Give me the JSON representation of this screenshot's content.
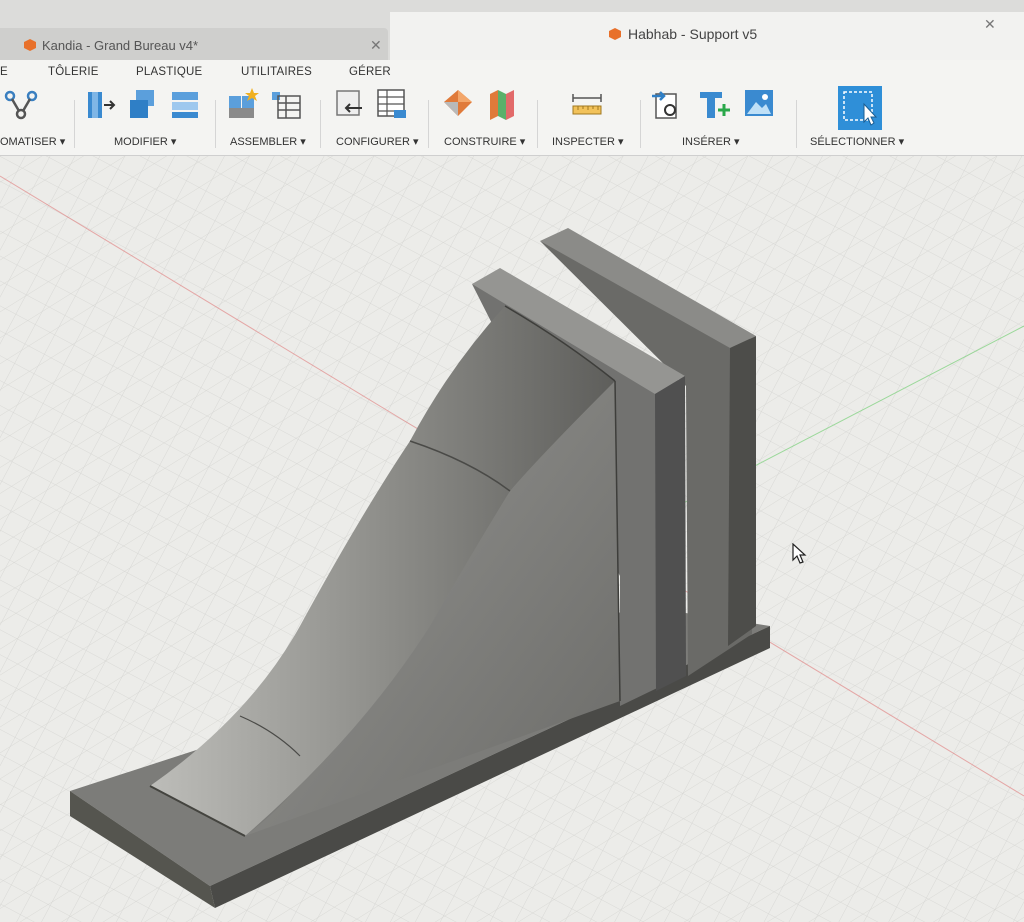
{
  "tabs": {
    "inactive": {
      "title": "Kandia - Grand Bureau v4*"
    },
    "active": {
      "title": "Habhab - Support v5"
    }
  },
  "menu_tabs": [
    "E",
    "TÔLERIE",
    "PLASTIQUE",
    "UTILITAIRES",
    "GÉRER"
  ],
  "groups": {
    "automatiser": "OMATISER ▾",
    "modifier": "MODIFIER ▾",
    "assembler": "ASSEMBLER ▾",
    "configurer": "CONFIGURER ▾",
    "construire": "CONSTRUIRE ▾",
    "inspecter": "INSPECTER ▾",
    "inserer": "INSÉRER ▾",
    "selectionner": "SÉLECTIONNER ▾"
  },
  "colors": {
    "accent": "#2f8fd8",
    "doc_icon": "#e8702a",
    "model": "#6a6a68",
    "grid": "#cfcfcc"
  },
  "icons": [
    "automatiser-icon",
    "push-pull-icon",
    "combine-icon",
    "shell-icon",
    "joint-icon",
    "table-icon",
    "configure-icon",
    "parameters-icon",
    "plane-icon",
    "midplane-icon",
    "measure-icon",
    "insert-link-icon",
    "insert-text-icon",
    "insert-image-icon",
    "select-icon",
    "cursor-icon"
  ]
}
